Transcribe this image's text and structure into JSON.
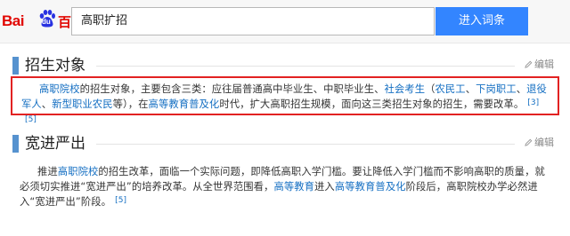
{
  "header": {
    "logo_text": "Bai",
    "logo_paw_text": "du",
    "logo_baike": "百科",
    "search_value": "高职扩招",
    "search_button": "进入词条"
  },
  "sections": [
    {
      "title": "招生对象",
      "edit_label": "编辑",
      "paragraph": {
        "segments": [
          {
            "text": "高职院校",
            "link": true
          },
          {
            "text": "的招生对象，主要包含三类：应往届普通高中毕业生、中职毕业生、",
            "link": false
          },
          {
            "text": "社会考生",
            "link": true
          },
          {
            "text": "（",
            "link": false
          },
          {
            "text": "农民工",
            "link": true
          },
          {
            "text": "、",
            "link": false
          },
          {
            "text": "下岗职工",
            "link": true
          },
          {
            "text": "、",
            "link": false
          },
          {
            "text": "退役军人",
            "link": true
          },
          {
            "text": "、",
            "link": false
          },
          {
            "text": "新型职业农民",
            "link": true
          },
          {
            "text": "等），在",
            "link": false
          },
          {
            "text": "高等教育普及化",
            "link": true
          },
          {
            "text": "时代，扩大高职招生规模，面向这三类招生对象的招生，需要改革。",
            "link": false
          }
        ],
        "refs": [
          "[3]",
          "[5]"
        ]
      }
    },
    {
      "title": "宽进严出",
      "edit_label": "编辑",
      "paragraph": {
        "segments": [
          {
            "text": "推进",
            "link": false
          },
          {
            "text": "高职院校",
            "link": true
          },
          {
            "text": "的招生改革，面临一个实际问题，即降低高职入学门槛。要让降低入学门槛而不影响高职的质量，就必须切实推进“宽进严出”的培养改革。从全世界范围看，",
            "link": false
          },
          {
            "text": "高等教育",
            "link": true
          },
          {
            "text": "进入",
            "link": false
          },
          {
            "text": "高等教育普及化",
            "link": true
          },
          {
            "text": "阶段后，高职院校办学必然进入“宽进严出”阶段。",
            "link": false
          }
        ],
        "refs": [
          "[5]"
        ]
      }
    }
  ],
  "colors": {
    "accent": "#3385ff",
    "link": "#136ec2",
    "section_marker": "#5692cf",
    "highlight": "#e22222",
    "brand": "#e10601"
  },
  "icons": [
    "baidu-paw-icon",
    "pencil-edit-icon"
  ]
}
